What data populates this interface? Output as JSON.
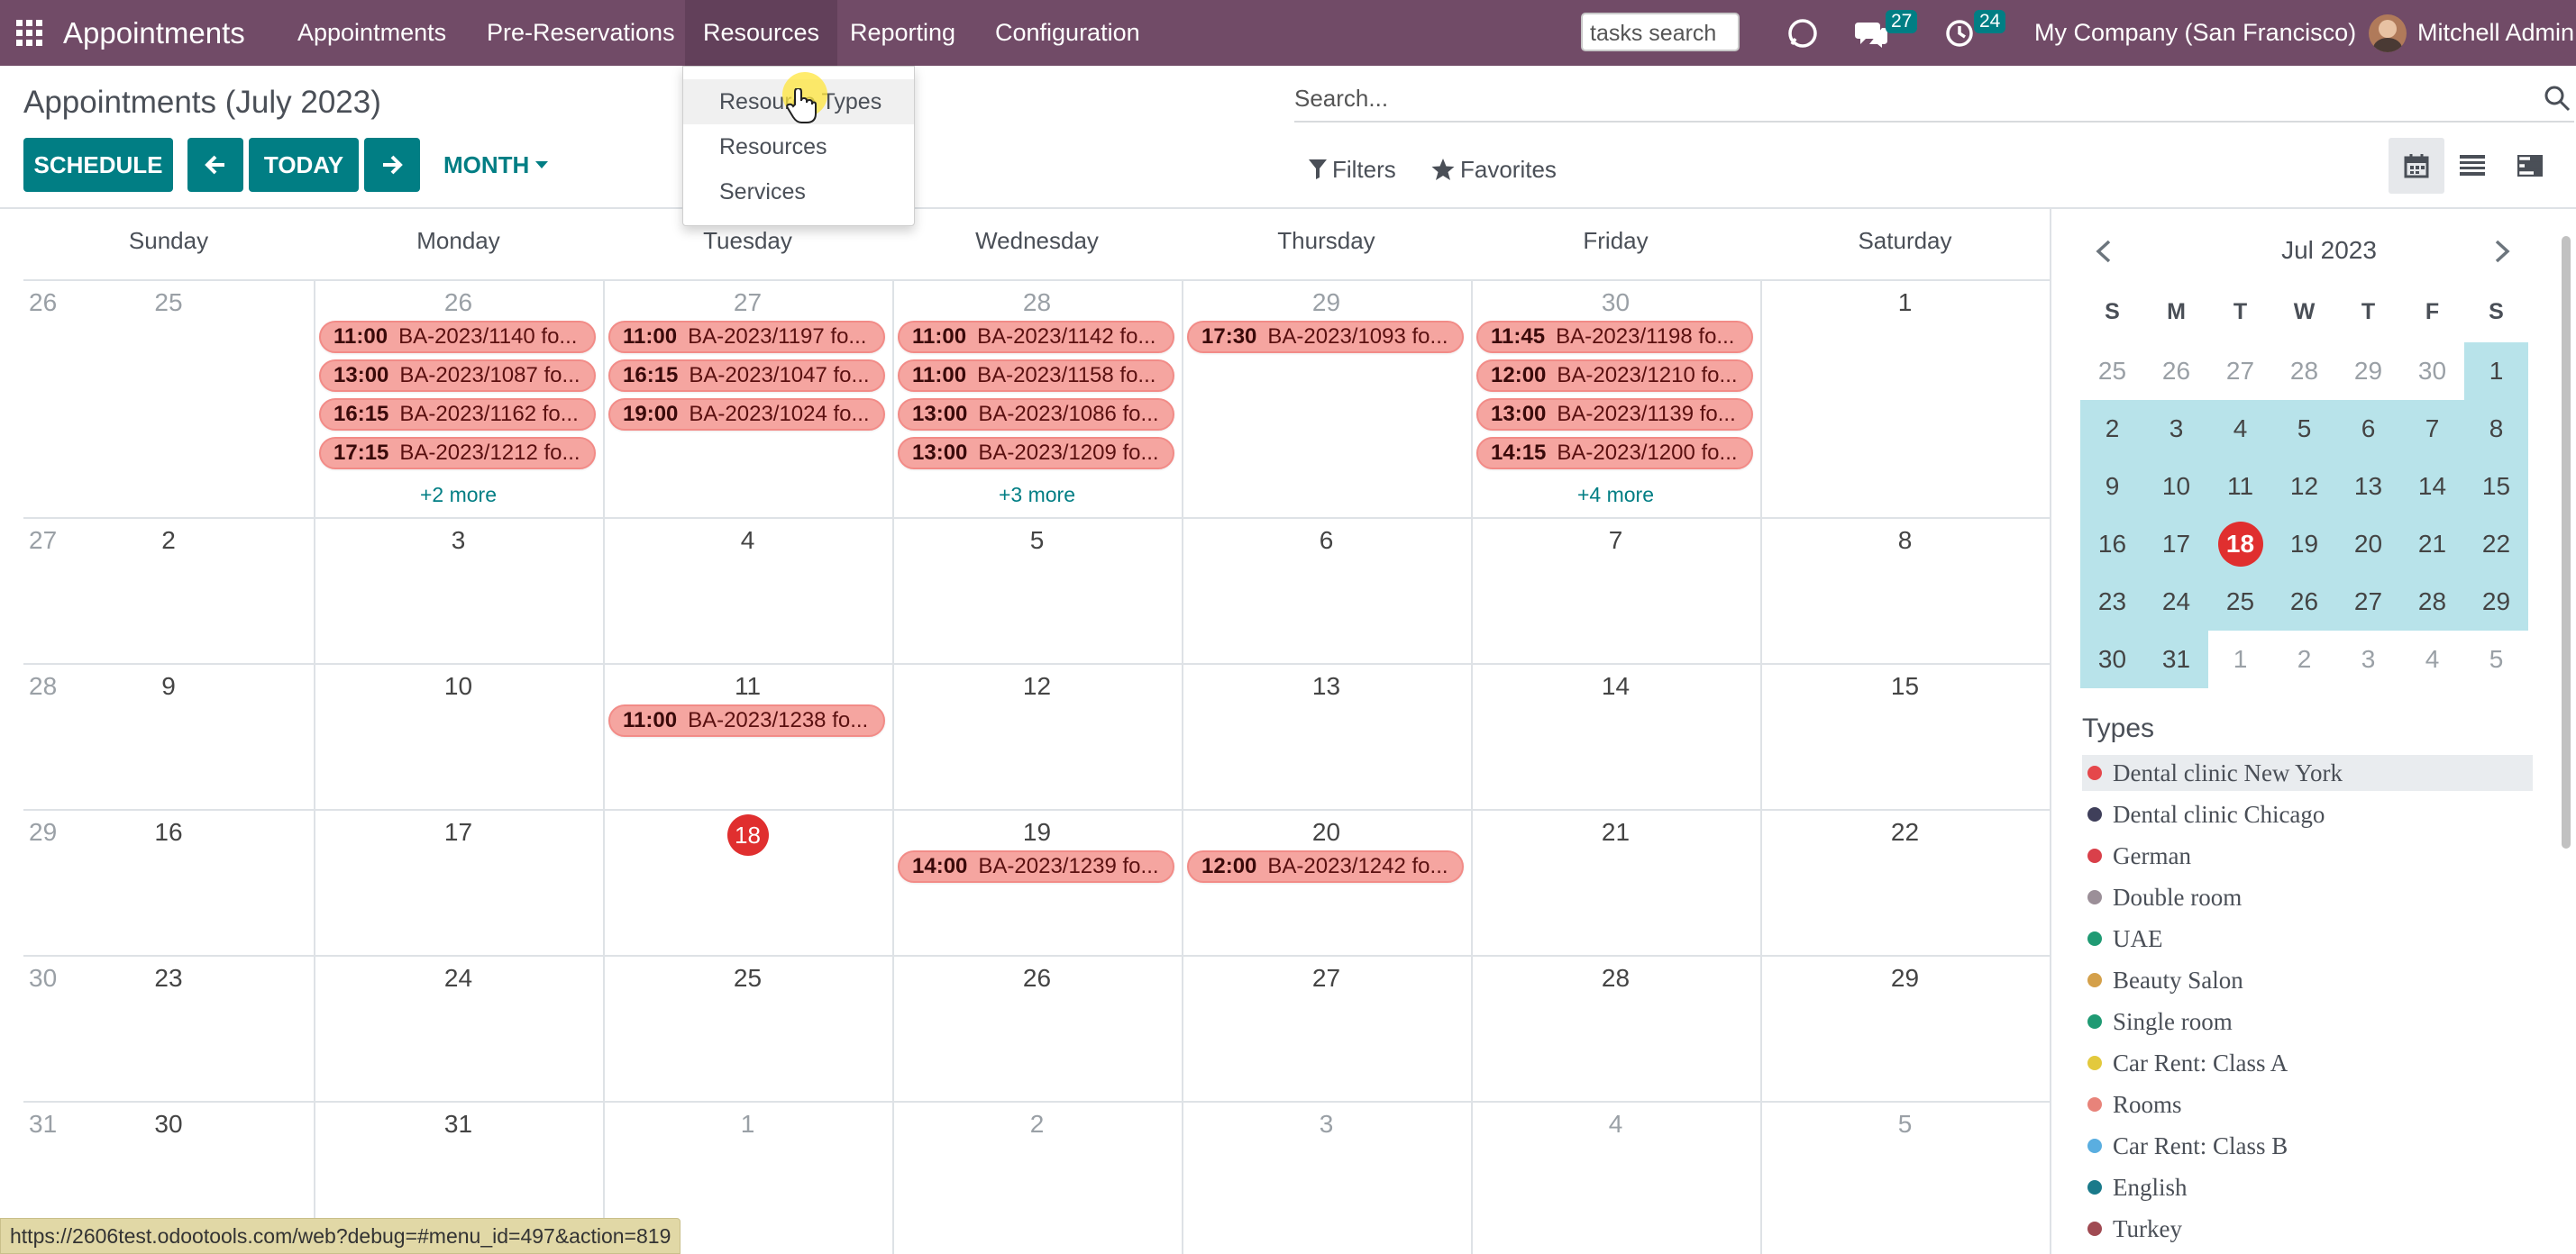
{
  "navbar": {
    "app_name": "Appointments",
    "menu": [
      "Appointments",
      "Pre-Reservations",
      "Resources",
      "Reporting",
      "Configuration"
    ],
    "tasks_search": "tasks search",
    "messages_count": "27",
    "activities_count": "24",
    "company": "My Company (San Francisco)",
    "user": "Mitchell Admin",
    "bg_color": "#714b67"
  },
  "dropdown": {
    "items": [
      "Resource Types",
      "Resources",
      "Services"
    ]
  },
  "control_panel": {
    "title": "Appointments (July 2023)",
    "schedule_label": "SCHEDULE",
    "today_label": "TODAY",
    "month_label": "MONTH",
    "search_placeholder": "Search...",
    "filters_label": "Filters",
    "favorites_label": "Favorites",
    "accent_color": "#017e84"
  },
  "calendar": {
    "day_headers": [
      "Sunday",
      "Monday",
      "Tuesday",
      "Wednesday",
      "Thursday",
      "Friday",
      "Saturday"
    ],
    "today": "18",
    "weeks": [
      {
        "num": "26",
        "days": [
          "25",
          "26",
          "27",
          "28",
          "29",
          "30",
          "1"
        ],
        "other_month": [
          true,
          true,
          true,
          true,
          true,
          true,
          false
        ],
        "events": [
          [],
          [
            {
              "time": "11:00",
              "label": "BA-2023/1140 fo..."
            },
            {
              "time": "13:00",
              "label": "BA-2023/1087 fo..."
            },
            {
              "time": "16:15",
              "label": "BA-2023/1162 fo..."
            },
            {
              "time": "17:15",
              "label": "BA-2023/1212 fo..."
            }
          ],
          [
            {
              "time": "11:00",
              "label": "BA-2023/1197 fo..."
            },
            {
              "time": "16:15",
              "label": "BA-2023/1047 fo..."
            },
            {
              "time": "19:00",
              "label": "BA-2023/1024 fo..."
            }
          ],
          [
            {
              "time": "11:00",
              "label": "BA-2023/1142 fo..."
            },
            {
              "time": "11:00",
              "label": "BA-2023/1158 fo..."
            },
            {
              "time": "13:00",
              "label": "BA-2023/1086 fo..."
            },
            {
              "time": "13:00",
              "label": "BA-2023/1209 fo..."
            }
          ],
          [
            {
              "time": "17:30",
              "label": "BA-2023/1093 fo..."
            }
          ],
          [
            {
              "time": "11:45",
              "label": "BA-2023/1198 fo..."
            },
            {
              "time": "12:00",
              "label": "BA-2023/1210 fo..."
            },
            {
              "time": "13:00",
              "label": "BA-2023/1139 fo..."
            },
            {
              "time": "14:15",
              "label": "BA-2023/1200 fo..."
            }
          ],
          []
        ],
        "more": [
          "",
          "+2 more",
          "",
          "+3 more",
          "",
          "+4 more",
          ""
        ]
      },
      {
        "num": "27",
        "days": [
          "2",
          "3",
          "4",
          "5",
          "6",
          "7",
          "8"
        ],
        "other_month": [
          false,
          false,
          false,
          false,
          false,
          false,
          false
        ],
        "events": [
          [],
          [],
          [],
          [],
          [],
          [],
          []
        ],
        "more": [
          "",
          "",
          "",
          "",
          "",
          "",
          ""
        ]
      },
      {
        "num": "28",
        "days": [
          "9",
          "10",
          "11",
          "12",
          "13",
          "14",
          "15"
        ],
        "other_month": [
          false,
          false,
          false,
          false,
          false,
          false,
          false
        ],
        "events": [
          [],
          [],
          [
            {
              "time": "11:00",
              "label": "BA-2023/1238 fo..."
            }
          ],
          [],
          [],
          [],
          []
        ],
        "more": [
          "",
          "",
          "",
          "",
          "",
          "",
          ""
        ]
      },
      {
        "num": "29",
        "days": [
          "16",
          "17",
          "18",
          "19",
          "20",
          "21",
          "22"
        ],
        "other_month": [
          false,
          false,
          false,
          false,
          false,
          false,
          false
        ],
        "events": [
          [],
          [],
          [],
          [
            {
              "time": "14:00",
              "label": "BA-2023/1239 fo..."
            }
          ],
          [
            {
              "time": "12:00",
              "label": "BA-2023/1242 fo..."
            }
          ],
          [],
          []
        ],
        "more": [
          "",
          "",
          "",
          "",
          "",
          "",
          ""
        ]
      },
      {
        "num": "30",
        "days": [
          "23",
          "24",
          "25",
          "26",
          "27",
          "28",
          "29"
        ],
        "other_month": [
          false,
          false,
          false,
          false,
          false,
          false,
          false
        ],
        "events": [
          [],
          [],
          [],
          [],
          [],
          [],
          []
        ],
        "more": [
          "",
          "",
          "",
          "",
          "",
          "",
          ""
        ]
      },
      {
        "num": "31",
        "days": [
          "30",
          "31",
          "1",
          "2",
          "3",
          "4",
          "5"
        ],
        "other_month": [
          false,
          false,
          true,
          true,
          true,
          true,
          true
        ],
        "events": [
          [],
          [],
          [],
          [],
          [],
          [],
          []
        ],
        "more": [
          "",
          "",
          "",
          "",
          "",
          "",
          ""
        ]
      }
    ],
    "event_color": "#f5a5a0",
    "today_color": "#e02f2f"
  },
  "mini_calendar": {
    "month_label": "Jul 2023",
    "dow": [
      "S",
      "M",
      "T",
      "W",
      "T",
      "F",
      "S"
    ],
    "rows": [
      [
        "25",
        "26",
        "27",
        "28",
        "29",
        "30",
        "1"
      ],
      [
        "2",
        "3",
        "4",
        "5",
        "6",
        "7",
        "8"
      ],
      [
        "9",
        "10",
        "11",
        "12",
        "13",
        "14",
        "15"
      ],
      [
        "16",
        "17",
        "18",
        "19",
        "20",
        "21",
        "22"
      ],
      [
        "23",
        "24",
        "25",
        "26",
        "27",
        "28",
        "29"
      ],
      [
        "30",
        "31",
        "1",
        "2",
        "3",
        "4",
        "5"
      ]
    ],
    "other_month": [
      [
        true,
        true,
        true,
        true,
        true,
        true,
        false
      ],
      [
        false,
        false,
        false,
        false,
        false,
        false,
        false
      ],
      [
        false,
        false,
        false,
        false,
        false,
        false,
        false
      ],
      [
        false,
        false,
        false,
        false,
        false,
        false,
        false
      ],
      [
        false,
        false,
        false,
        false,
        false,
        false,
        false
      ],
      [
        false,
        false,
        true,
        true,
        true,
        true,
        true
      ]
    ],
    "today": "18",
    "highlight_color": "#b8e3ea"
  },
  "types": {
    "title": "Types",
    "items": [
      {
        "label": "Dental clinic New York",
        "color": "#e5474b",
        "active": true
      },
      {
        "label": "Dental clinic Chicago",
        "color": "#3f3f5a",
        "active": false
      },
      {
        "label": "German",
        "color": "#d9404a",
        "active": false
      },
      {
        "label": "Double room",
        "color": "#9b8f98",
        "active": false
      },
      {
        "label": "UAE",
        "color": "#1f9a73",
        "active": false
      },
      {
        "label": "Beauty Salon",
        "color": "#d4a04a",
        "active": false
      },
      {
        "label": "Single room",
        "color": "#1f9a73",
        "active": false
      },
      {
        "label": "Car Rent: Class A",
        "color": "#e3c93d",
        "active": false
      },
      {
        "label": "Rooms",
        "color": "#e8837a",
        "active": false
      },
      {
        "label": "Car Rent: Class B",
        "color": "#5aaee0",
        "active": false
      },
      {
        "label": "English",
        "color": "#1a7a8a",
        "active": false
      },
      {
        "label": "Turkey",
        "color": "#a04a52",
        "active": false
      }
    ]
  },
  "statusbar": {
    "url": "https://2606test.odootools.com/web?debug=#menu_id=497&action=819"
  }
}
